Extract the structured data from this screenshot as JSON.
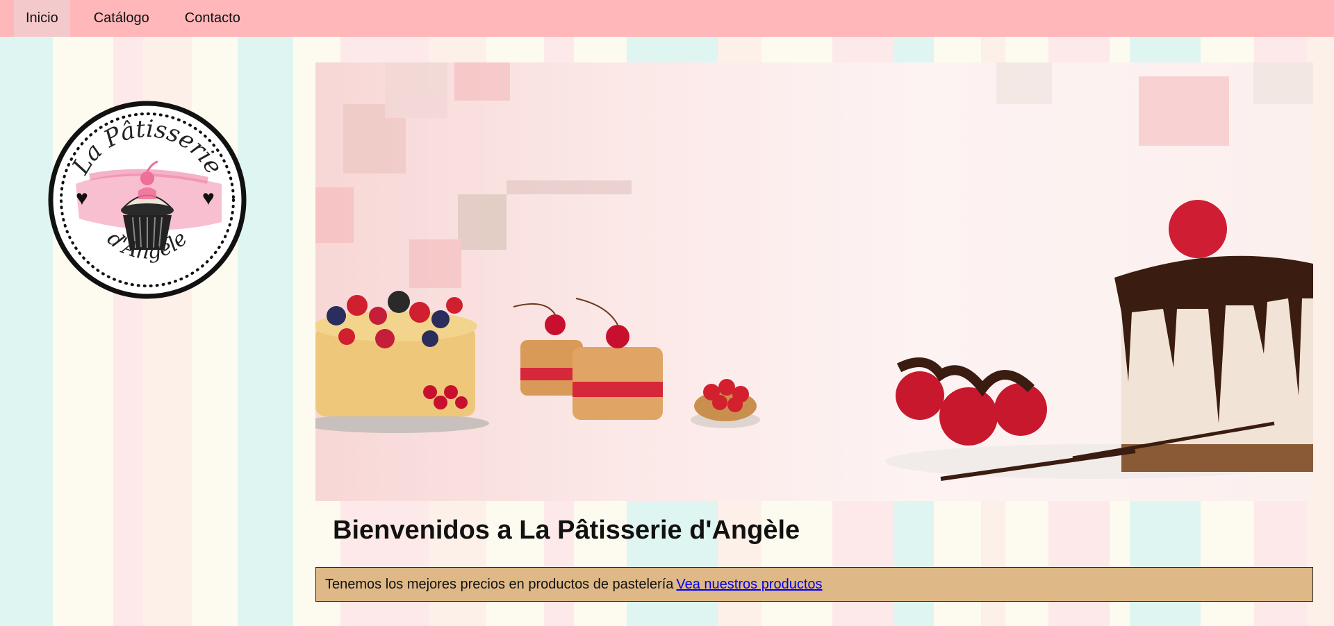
{
  "nav": {
    "items": [
      {
        "label": "Inicio",
        "active": true
      },
      {
        "label": "Catálogo",
        "active": false
      },
      {
        "label": "Contacto",
        "active": false
      }
    ]
  },
  "logo": {
    "top_text": "La Pâtisserie",
    "bottom_text": "d'Angèle",
    "icon": "cupcake-icon"
  },
  "banner": {
    "description_icon": "pastry-banner-image"
  },
  "main": {
    "title": "Bienvenidos a La Pâtisserie d'Angèle",
    "promo_text": "Tenemos los mejores precios en productos de pastelería",
    "promo_link": "Vea nuestros productos"
  },
  "colors": {
    "nav_bg": "#ffb7b9",
    "promo_bg": "#deb887",
    "link": "#0000ee"
  }
}
